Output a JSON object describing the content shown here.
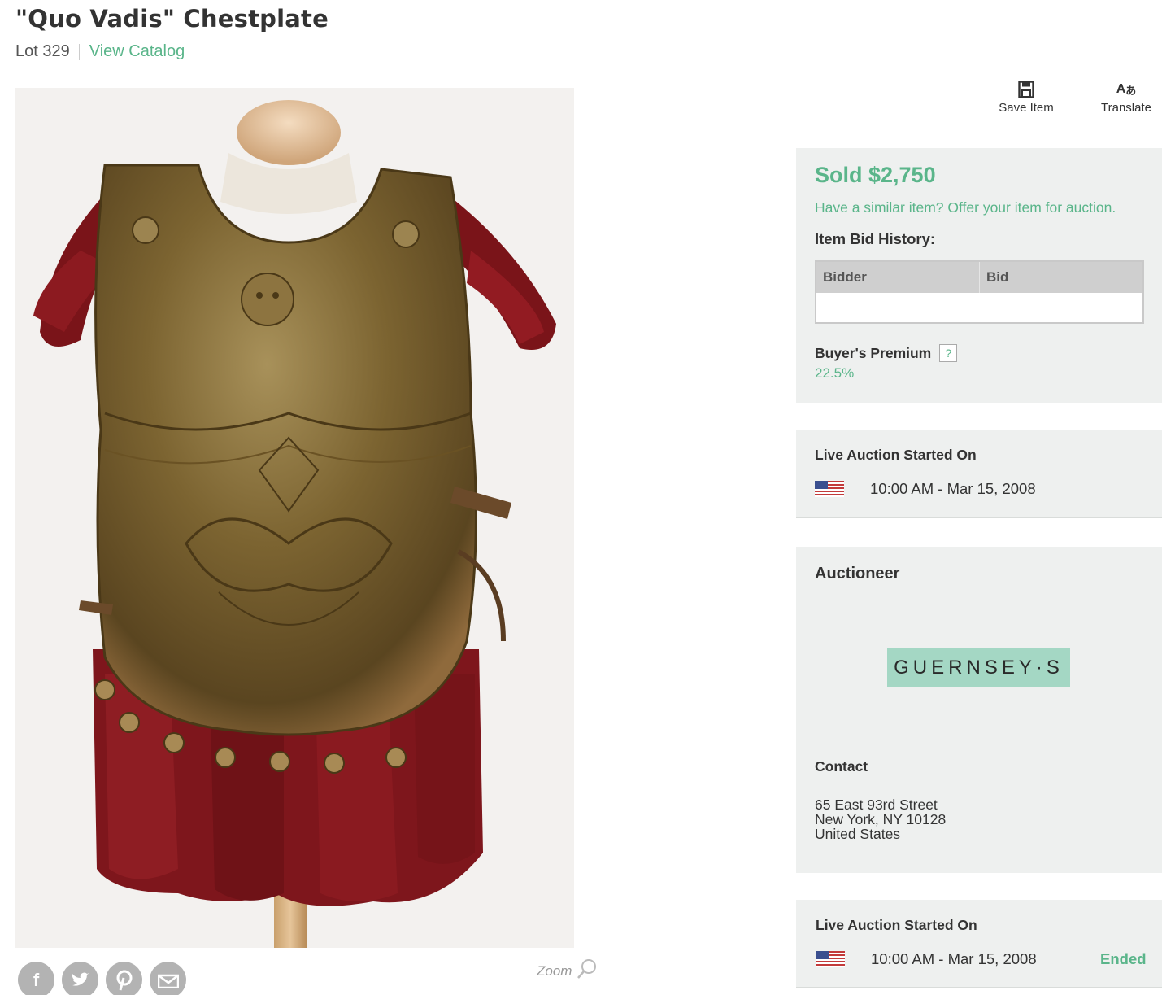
{
  "header": {
    "title": "\"Quo Vadis\" Chestplate",
    "lot": "Lot 329",
    "view_catalog": "View Catalog"
  },
  "tools": {
    "save_label": "Save Item",
    "translate_label": "Translate"
  },
  "image": {
    "subject": "Roman-style bronze chestplate with red leather straps on a mannequin",
    "zoom_label": "Zoom"
  },
  "social": {
    "icons": [
      "facebook-icon",
      "twitter-icon",
      "pinterest-icon",
      "email-icon"
    ]
  },
  "sale": {
    "sold_text": "Sold $2,750",
    "similar_text": "Have a similar item? Offer your item for auction.",
    "bid_history_heading": "Item Bid History:",
    "bid_columns": [
      "Bidder",
      "Bid"
    ],
    "buyers_premium_label": "Buyer's Premium",
    "buyers_premium_help": "?",
    "buyers_premium_value": "22.5%"
  },
  "live_auction": {
    "heading": "Live Auction Started On",
    "time": "10:00 AM - Mar 15, 2008"
  },
  "auctioneer": {
    "heading": "Auctioneer",
    "logo_text": "GUERNSEY·S",
    "contact_heading": "Contact",
    "address_line1": "65 East 93rd Street",
    "address_line2": "New York, NY 10128",
    "address_line3": "United States"
  },
  "live_auction_2": {
    "heading": "Live Auction Started On",
    "time": "10:00 AM - Mar 15, 2008",
    "status": "Ended"
  },
  "colors": {
    "accent_green": "#5ab58a",
    "panel_bg": "#eef0ef",
    "logo_bg": "#a4d7c4"
  }
}
